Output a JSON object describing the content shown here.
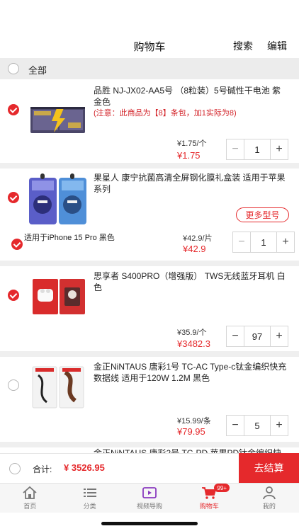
{
  "header": {
    "title": "购物车",
    "search_label": "搜索",
    "edit_label": "编辑"
  },
  "select_all_label": "全部",
  "items": [
    {
      "name": "品胜 NJ-JX02-AA5号 （8粒装）5号碱性干电池 紫金色",
      "note": "(注意：此商品为【8】条包，加1实际为8)",
      "unit_price": "¥1.75/个",
      "price": "¥1.75",
      "qty": "1",
      "checked": true
    },
    {
      "name": "果星人 康宁抗菌高清全屏钢化膜礼盒装 适用于苹果系列",
      "more_label": "更多型号",
      "variant": "适用于iPhone 15 Pro 黑色",
      "unit_price": "¥42.9/片",
      "price": "¥42.9",
      "qty": "1",
      "checked": true
    },
    {
      "name": "思享者 S400PRO（增强版） TWS无线蓝牙耳机 白色",
      "unit_price": "¥35.9/个",
      "price": "¥3482.3",
      "qty": "97",
      "checked": true
    },
    {
      "name": "金正NiNTAUS 唐彩1号 TC-AC Type-c钛金编织快充数据线 适用于120W 1.2M 黑色",
      "unit_price": "¥15.99/条",
      "price": "¥79.95",
      "qty": "5",
      "checked": false
    },
    {
      "name": "金正NiNTAUS 唐彩2号 TC-PD 苹果PD钛金编织快"
    }
  ],
  "footer": {
    "total_label": "合计:",
    "total_value": "¥ 3526.95",
    "checkout_label": "去结算"
  },
  "tabs": [
    {
      "label": "首页",
      "icon": "home-icon"
    },
    {
      "label": "分类",
      "icon": "list-icon"
    },
    {
      "label": "视频导购",
      "icon": "video-icon"
    },
    {
      "label": "购物车",
      "icon": "cart-icon",
      "badge": "99+",
      "active": true
    },
    {
      "label": "我的",
      "icon": "user-icon"
    }
  ],
  "colors": {
    "accent": "#e5292c",
    "divider": "#efefef",
    "select_all_bg": "#ececec"
  }
}
